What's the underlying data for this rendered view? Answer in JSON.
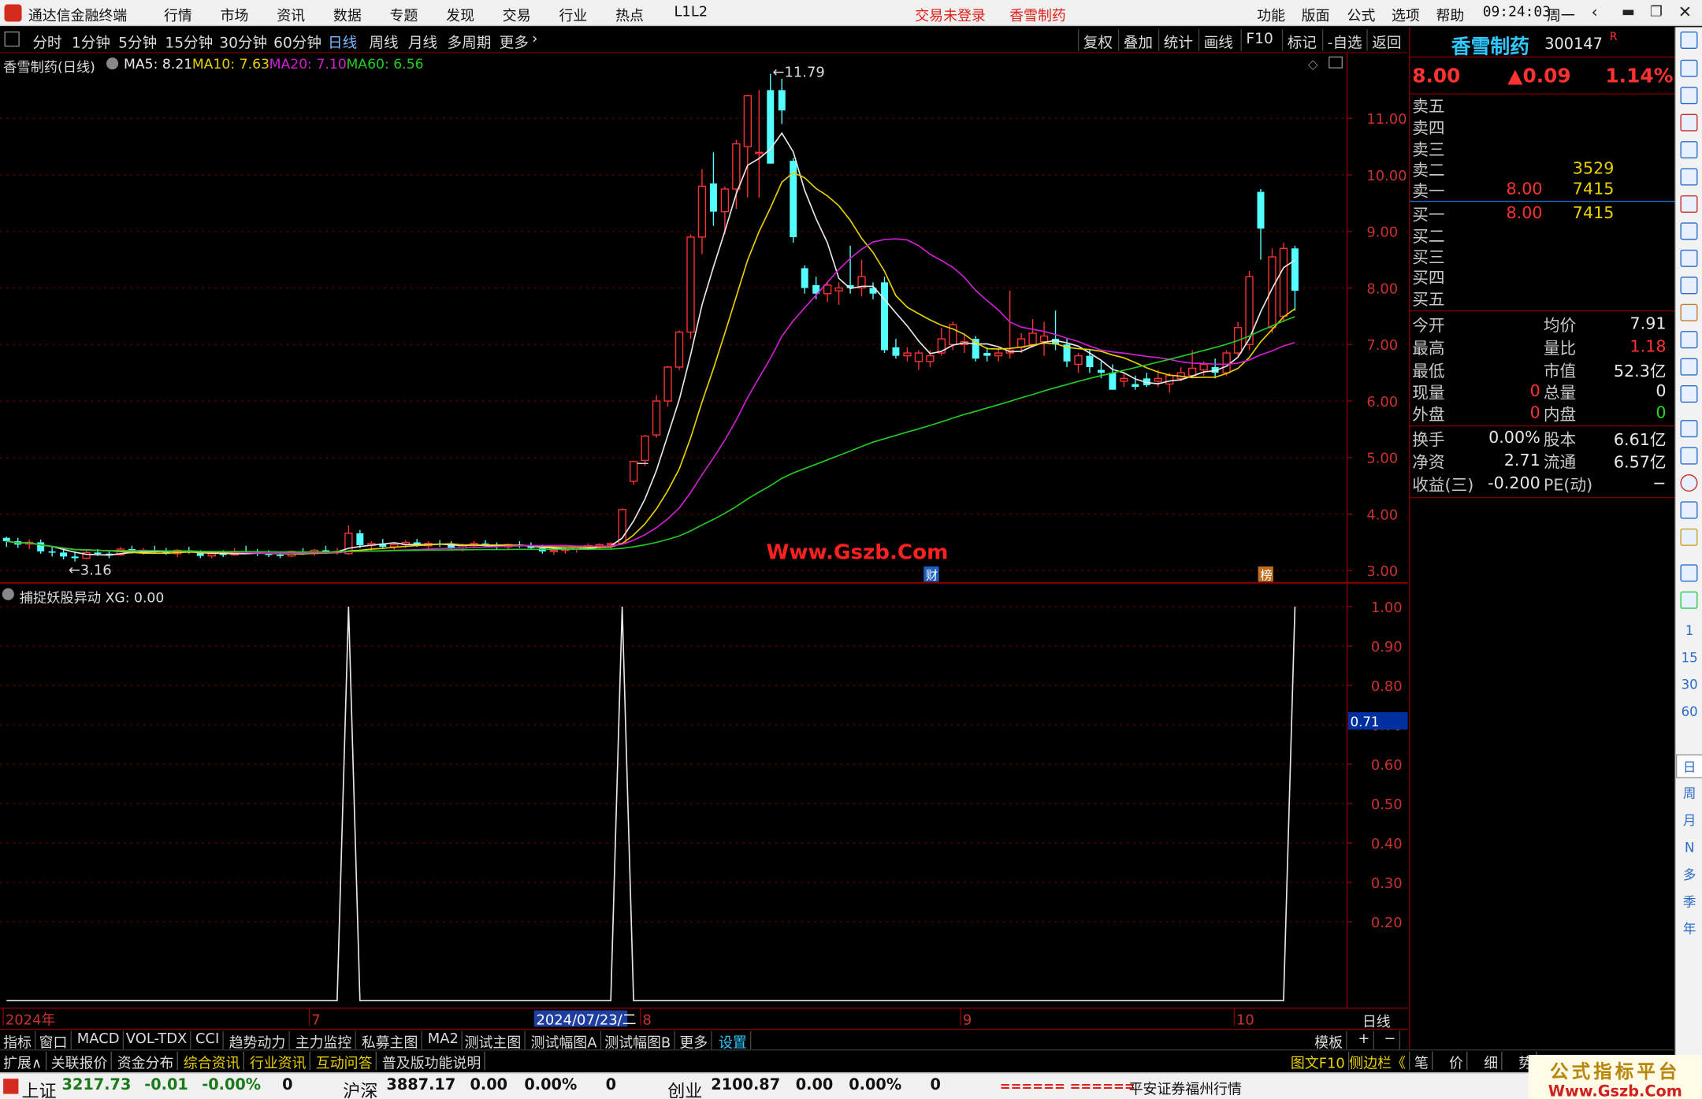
{
  "menu": {
    "app_title": "通达信金融终端",
    "items": [
      "行情",
      "市场",
      "资讯",
      "数据",
      "专题",
      "发现",
      "交易",
      "行业",
      "热点",
      "L1L2"
    ],
    "warn1": "交易未登录",
    "warn2": "香雪制药",
    "right_items": [
      "功能",
      "版面",
      "公式",
      "选项",
      "帮助"
    ],
    "clock": "09:24:03",
    "weekday": "周一"
  },
  "periods": [
    "分时",
    "1分钟",
    "5分钟",
    "15分钟",
    "30分钟",
    "60分钟",
    "日线",
    "周线",
    "月线",
    "多周期",
    "更多"
  ],
  "active_period": "日线",
  "chart_tools": [
    "复权",
    "叠加",
    "统计",
    "画线",
    "F10",
    "标记",
    "-自选",
    "返回"
  ],
  "main_header": {
    "name": "香雪制药(日线)",
    "ma5": "MA5: 8.21",
    "ma10": "MA10: 7.63",
    "ma20": "MA20: 7.10",
    "ma60": "MA60: 6.56"
  },
  "sub_header": "捕捉妖股异动 XG: 0.00",
  "chart_data": [
    {
      "type": "candlestick",
      "title": "香雪制药(日线)",
      "y_ticks": [
        "11.00",
        "10.00",
        "9.00",
        "8.00",
        "7.00",
        "6.00",
        "5.00",
        "4.00",
        "3.00"
      ],
      "ylim": [
        2.9,
        12.0
      ],
      "high_label": "11.79",
      "low_label": "3.16",
      "x_labels": [
        "2024年",
        "7",
        "2024/07/23/二",
        "8",
        "9",
        "10"
      ],
      "markers": [
        "财",
        "榜"
      ],
      "watermark": "Www.Gszb.Com",
      "candles": [
        [
          3.58,
          3.6,
          3.42,
          3.52
        ],
        [
          3.52,
          3.58,
          3.4,
          3.46
        ],
        [
          3.47,
          3.55,
          3.38,
          3.5
        ],
        [
          3.5,
          3.55,
          3.3,
          3.34
        ],
        [
          3.34,
          3.42,
          3.25,
          3.32
        ],
        [
          3.32,
          3.4,
          3.2,
          3.25
        ],
        [
          3.25,
          3.34,
          3.16,
          3.22
        ],
        [
          3.22,
          3.36,
          3.2,
          3.32
        ],
        [
          3.32,
          3.38,
          3.26,
          3.3
        ],
        [
          3.3,
          3.36,
          3.22,
          3.28
        ],
        [
          3.28,
          3.42,
          3.26,
          3.38
        ],
        [
          3.38,
          3.44,
          3.3,
          3.32
        ],
        [
          3.32,
          3.4,
          3.28,
          3.36
        ],
        [
          3.36,
          3.44,
          3.3,
          3.34
        ],
        [
          3.34,
          3.4,
          3.28,
          3.3
        ],
        [
          3.3,
          3.38,
          3.24,
          3.36
        ],
        [
          3.36,
          3.42,
          3.3,
          3.32
        ],
        [
          3.32,
          3.36,
          3.22,
          3.26
        ],
        [
          3.26,
          3.34,
          3.22,
          3.3
        ],
        [
          3.3,
          3.36,
          3.24,
          3.28
        ],
        [
          3.28,
          3.4,
          3.26,
          3.34
        ],
        [
          3.34,
          3.44,
          3.3,
          3.32
        ],
        [
          3.32,
          3.38,
          3.26,
          3.3
        ],
        [
          3.3,
          3.36,
          3.24,
          3.28
        ],
        [
          3.28,
          3.34,
          3.22,
          3.26
        ],
        [
          3.26,
          3.36,
          3.24,
          3.34
        ],
        [
          3.34,
          3.4,
          3.28,
          3.3
        ],
        [
          3.3,
          3.38,
          3.26,
          3.36
        ],
        [
          3.36,
          3.44,
          3.3,
          3.32
        ],
        [
          3.32,
          3.4,
          3.28,
          3.34
        ],
        [
          3.3,
          3.8,
          3.28,
          3.66
        ],
        [
          3.66,
          3.72,
          3.4,
          3.45
        ],
        [
          3.45,
          3.52,
          3.36,
          3.48
        ],
        [
          3.48,
          3.56,
          3.4,
          3.42
        ],
        [
          3.42,
          3.5,
          3.36,
          3.46
        ],
        [
          3.46,
          3.54,
          3.4,
          3.5
        ],
        [
          3.5,
          3.56,
          3.42,
          3.44
        ],
        [
          3.44,
          3.52,
          3.38,
          3.48
        ],
        [
          3.48,
          3.54,
          3.42,
          3.46
        ],
        [
          3.46,
          3.52,
          3.38,
          3.4
        ],
        [
          3.4,
          3.48,
          3.34,
          3.44
        ],
        [
          3.44,
          3.52,
          3.4,
          3.48
        ],
        [
          3.48,
          3.54,
          3.42,
          3.44
        ],
        [
          3.44,
          3.5,
          3.38,
          3.42
        ],
        [
          3.42,
          3.48,
          3.36,
          3.46
        ],
        [
          3.46,
          3.52,
          3.4,
          3.44
        ],
        [
          3.44,
          3.5,
          3.38,
          3.4
        ],
        [
          3.4,
          3.46,
          3.3,
          3.34
        ],
        [
          3.34,
          3.4,
          3.28,
          3.36
        ],
        [
          3.36,
          3.42,
          3.3,
          3.38
        ],
        [
          3.38,
          3.44,
          3.32,
          3.42
        ],
        [
          3.42,
          3.48,
          3.36,
          3.44
        ],
        [
          3.44,
          3.48,
          3.38,
          3.46
        ],
        [
          3.46,
          3.5,
          3.4,
          3.48
        ],
        [
          3.48,
          4.1,
          3.46,
          4.08
        ],
        [
          4.58,
          4.95,
          4.52,
          4.93
        ],
        [
          4.95,
          5.4,
          4.85,
          5.38
        ],
        [
          5.4,
          6.1,
          5.35,
          6.0
        ],
        [
          6.0,
          6.62,
          5.9,
          6.6
        ],
        [
          6.6,
          7.25,
          6.55,
          7.22
        ],
        [
          7.22,
          8.95,
          7.1,
          8.9
        ],
        [
          8.9,
          10.1,
          8.6,
          9.8
        ],
        [
          9.85,
          10.4,
          9.1,
          9.35
        ],
        [
          9.35,
          9.8,
          8.95,
          9.75
        ],
        [
          9.75,
          10.62,
          9.4,
          10.55
        ],
        [
          10.5,
          11.42,
          9.6,
          11.4
        ],
        [
          10.4,
          11.5,
          9.6,
          10.4
        ],
        [
          11.5,
          11.79,
          10.2,
          10.2
        ],
        [
          11.5,
          11.7,
          10.9,
          11.14
        ],
        [
          10.25,
          10.3,
          8.8,
          8.9
        ],
        [
          8.35,
          8.4,
          7.9,
          8.0
        ],
        [
          8.05,
          8.2,
          7.8,
          7.9
        ],
        [
          7.9,
          8.1,
          7.75,
          8.05
        ],
        [
          7.95,
          8.1,
          7.7,
          8.0
        ],
        [
          8.05,
          8.75,
          7.9,
          8.0
        ],
        [
          8.0,
          8.5,
          7.85,
          8.2
        ],
        [
          8.0,
          8.1,
          7.8,
          7.9
        ],
        [
          8.1,
          8.2,
          6.85,
          6.9
        ],
        [
          6.95,
          7.1,
          6.75,
          6.8
        ],
        [
          6.8,
          6.95,
          6.7,
          6.85
        ],
        [
          6.7,
          6.9,
          6.55,
          6.85
        ],
        [
          6.7,
          6.9,
          6.6,
          6.8
        ],
        [
          6.85,
          7.3,
          6.8,
          7.1
        ],
        [
          7.0,
          7.4,
          6.9,
          7.35
        ],
        [
          7.0,
          7.2,
          6.85,
          7.05
        ],
        [
          7.1,
          7.15,
          6.7,
          6.75
        ],
        [
          6.85,
          6.95,
          6.7,
          6.8
        ],
        [
          6.8,
          6.95,
          6.7,
          6.85
        ],
        [
          6.85,
          7.95,
          6.75,
          6.9
        ],
        [
          6.95,
          7.2,
          6.85,
          7.1
        ],
        [
          7.0,
          7.45,
          6.95,
          7.2
        ],
        [
          7.05,
          7.4,
          6.8,
          7.15
        ],
        [
          7.1,
          7.6,
          6.9,
          7.0
        ],
        [
          7.0,
          7.1,
          6.6,
          6.7
        ],
        [
          6.65,
          6.85,
          6.5,
          6.8
        ],
        [
          6.8,
          6.9,
          6.5,
          6.6
        ],
        [
          6.55,
          6.7,
          6.4,
          6.5
        ],
        [
          6.5,
          6.65,
          6.2,
          6.2
        ],
        [
          6.35,
          6.5,
          6.25,
          6.4
        ],
        [
          6.3,
          6.45,
          6.2,
          6.25
        ],
        [
          6.4,
          6.5,
          6.25,
          6.28
        ],
        [
          6.35,
          6.55,
          6.25,
          6.4
        ],
        [
          6.3,
          6.5,
          6.15,
          6.45
        ],
        [
          6.4,
          6.6,
          6.35,
          6.5
        ],
        [
          6.45,
          6.9,
          6.4,
          6.58
        ],
        [
          6.55,
          6.7,
          6.45,
          6.65
        ],
        [
          6.6,
          6.75,
          6.4,
          6.5
        ],
        [
          6.5,
          6.9,
          6.45,
          6.85
        ],
        [
          6.85,
          7.4,
          6.8,
          7.3
        ],
        [
          7.0,
          8.3,
          6.9,
          8.2
        ],
        [
          9.7,
          9.75,
          8.5,
          9.05
        ],
        [
          7.3,
          8.7,
          7.2,
          8.55
        ],
        [
          7.5,
          8.8,
          7.4,
          8.7
        ],
        [
          8.7,
          8.75,
          7.6,
          7.95
        ]
      ],
      "series": [
        {
          "name": "MA5",
          "color": "#e8e8e8"
        },
        {
          "name": "MA10",
          "color": "#e8d000"
        },
        {
          "name": "MA20",
          "color": "#d020d0"
        },
        {
          "name": "MA60",
          "color": "#22cc22"
        }
      ]
    },
    {
      "type": "line",
      "title": "捕捉妖股异动",
      "y_ticks": [
        "1.00",
        "0.90",
        "0.80",
        "0.70",
        "0.60",
        "0.50",
        "0.40",
        "0.30",
        "0.20"
      ],
      "ylim": [
        0,
        1.0
      ],
      "current_label": "0.71",
      "spikes_at_candle_index": [
        30,
        54,
        113
      ],
      "series": [
        {
          "name": "XG",
          "color": "#e8e8e8"
        }
      ]
    }
  ],
  "bottom_tabs1": [
    "指标",
    "窗口",
    "MACD",
    "VOL-TDX",
    "CCI",
    "趋势动力",
    "主力监控",
    "私募主图",
    "MA2",
    "测试主图",
    "测试幅图A",
    "测试幅图B",
    "更多",
    "设置"
  ],
  "bottom_tabs1_right": [
    "模板",
    "+",
    "−"
  ],
  "bottom_tabs2": [
    "扩展∧",
    "关联报价",
    "资金分布",
    "综合资讯",
    "行业资讯",
    "互动问答",
    "普及版功能说明"
  ],
  "bottom_tabs2_right": [
    "图文F10",
    "侧边栏《",
    "笔",
    "价",
    "细",
    "势"
  ],
  "period_label": "日线",
  "quote": {
    "name": "香雪制药",
    "code": "300147",
    "flag": "R",
    "price": "8.00",
    "change": "▲0.09",
    "pct": "1.14%",
    "asks": [
      {
        "label": "卖五",
        "price": "",
        "vol": ""
      },
      {
        "label": "卖四",
        "price": "",
        "vol": ""
      },
      {
        "label": "卖三",
        "price": "",
        "vol": ""
      },
      {
        "label": "卖二",
        "price": "",
        "vol": "3529"
      },
      {
        "label": "卖一",
        "price": "8.00",
        "vol": "7415"
      }
    ],
    "bids": [
      {
        "label": "买一",
        "price": "8.00",
        "vol": "7415"
      },
      {
        "label": "买二",
        "price": "",
        "vol": ""
      },
      {
        "label": "买三",
        "price": "",
        "vol": ""
      },
      {
        "label": "买四",
        "price": "",
        "vol": ""
      },
      {
        "label": "买五",
        "price": "",
        "vol": ""
      }
    ],
    "stats1": [
      {
        "l": "今开",
        "v": "",
        "r": "均价",
        "rv": "7.91"
      },
      {
        "l": "最高",
        "v": "",
        "r": "量比",
        "rv": "1.18"
      },
      {
        "l": "最低",
        "v": "",
        "r": "市值",
        "rv": "52.3亿"
      },
      {
        "l": "现量",
        "v": "0",
        "r": "总量",
        "rv": "0"
      },
      {
        "l": "外盘",
        "v": "0",
        "r": "内盘",
        "rv": "0"
      }
    ],
    "stats2": [
      {
        "l": "换手",
        "v": "0.00%",
        "r": "股本",
        "rv": "6.61亿"
      },
      {
        "l": "净资",
        "v": "2.71",
        "r": "流通",
        "rv": "6.57亿"
      },
      {
        "l": "收益(三)",
        "v": "-0.200",
        "r": "PE(动)",
        "rv": "−"
      }
    ]
  },
  "sidebar_nums": [
    "1",
    "15",
    "30",
    "60",
    "日",
    "周",
    "月",
    "N",
    "多",
    "季",
    "年"
  ],
  "status": {
    "idx1_name": "上证",
    "idx1_val": "3217.73",
    "idx1_chg": "-0.01",
    "idx1_pct": "-0.00%",
    "idx1_vol": "0",
    "idx2_name": "沪深",
    "idx2_val": "3887.17",
    "idx2_chg": "0.00",
    "idx2_pct": "0.00%",
    "idx2_vol": "0",
    "idx3_name": "创业",
    "idx3_val": "2100.87",
    "idx3_chg": "0.00",
    "idx3_pct": "0.00%",
    "idx3_vol": "0",
    "bars": "====== ======",
    "broker": "平安证券福州行情",
    "brand1": "公式指标平台",
    "brand2": "Www.Gszb.Com"
  }
}
